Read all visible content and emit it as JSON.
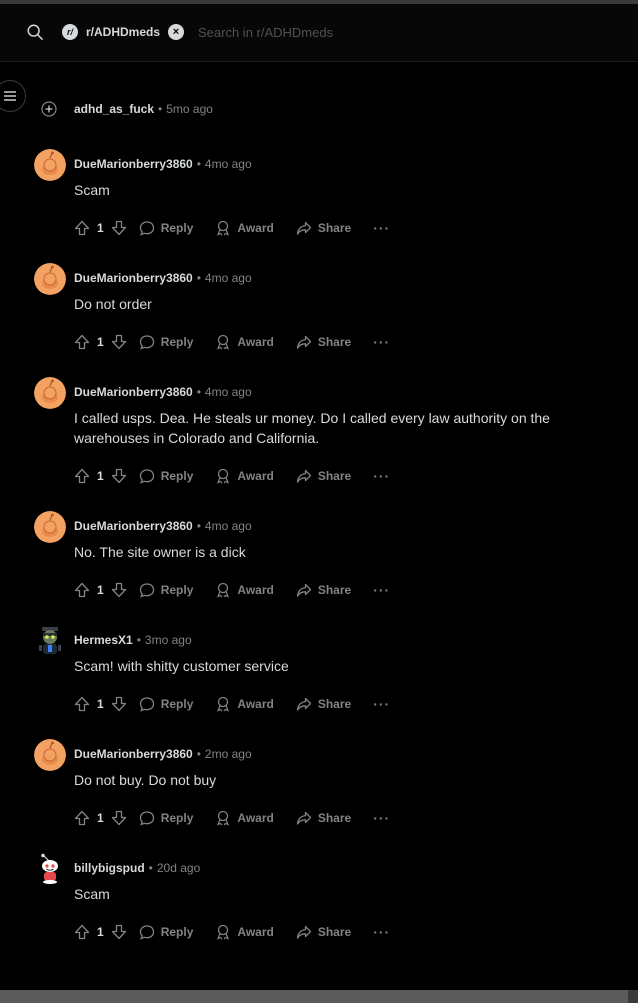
{
  "header": {
    "subreddit_icon": "r/",
    "subreddit": "r/ADHDmeds",
    "search_placeholder": "Search in r/ADHDmeds"
  },
  "collapsed": {
    "author": "adhd_as_fuck",
    "separator": "•",
    "time": "5mo ago"
  },
  "action_labels": {
    "reply": "Reply",
    "award": "Award",
    "share": "Share",
    "more": "···"
  },
  "comments": [
    {
      "author": "DueMarionberry3860",
      "sep": "•",
      "time": "4mo ago",
      "body": "Scam",
      "votes": "1",
      "avatar": "snoo-orange"
    },
    {
      "author": "DueMarionberry3860",
      "sep": "•",
      "time": "4mo ago",
      "body": "Do not order",
      "votes": "1",
      "avatar": "snoo-orange"
    },
    {
      "author": "DueMarionberry3860",
      "sep": "•",
      "time": "4mo ago",
      "body": "I called usps. Dea. He steals ur money. Do I called every law authority on the warehouses in Colorado and California.",
      "votes": "1",
      "avatar": "snoo-orange"
    },
    {
      "author": "DueMarionberry3860",
      "sep": "•",
      "time": "4mo ago",
      "body": "No. The site owner is a dick",
      "votes": "1",
      "avatar": "snoo-orange"
    },
    {
      "author": "HermesX1",
      "sep": "•",
      "time": "3mo ago",
      "body": "Scam! with shitty customer service",
      "votes": "1",
      "avatar": "snoo-custom-dark"
    },
    {
      "author": "DueMarionberry3860",
      "sep": "•",
      "time": "2mo ago",
      "body": "Do not buy. Do not buy",
      "votes": "1",
      "avatar": "snoo-orange"
    },
    {
      "author": "billybigspud",
      "sep": "•",
      "time": "20d ago",
      "body": "Scam",
      "votes": "1",
      "avatar": "snoo-white-red"
    }
  ],
  "colors": {
    "background": "#000000",
    "text": "#d7dadc",
    "muted": "#818384",
    "avatar_orange": "#f4a261"
  }
}
